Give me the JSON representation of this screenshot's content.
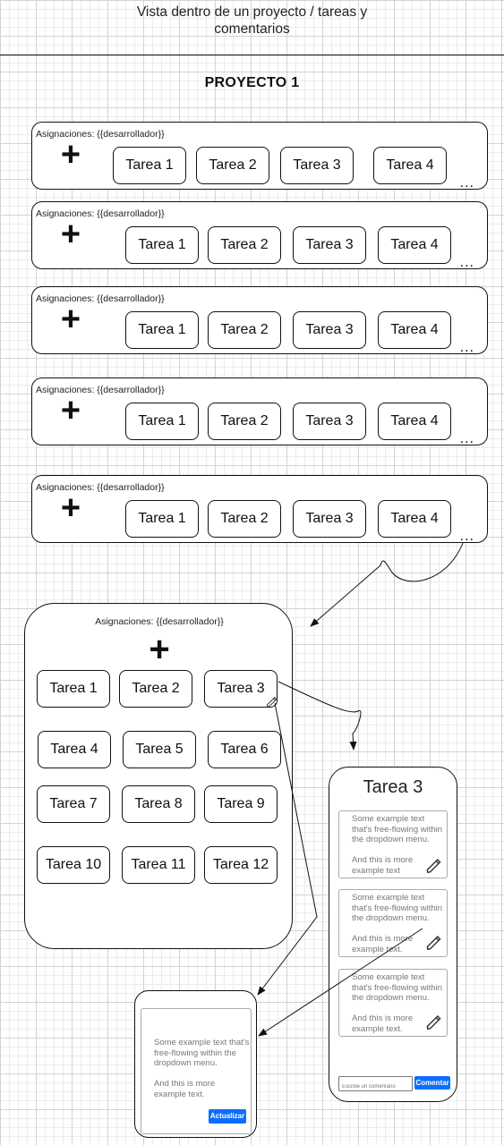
{
  "header": {
    "title_line1": "Vista dentro de un proyecto / tareas y",
    "title_line2": "comentarios",
    "project_title": "PROYECTO 1"
  },
  "rows": [
    {
      "label": "Asignaciones: {{desarrollador}}",
      "plus": "+",
      "tasks": [
        "Tarea 1",
        "Tarea 2",
        "Tarea 3",
        "Tarea 4"
      ],
      "more": "..."
    },
    {
      "label": "Asignaciones: {{desarrollador}}",
      "plus": "+",
      "tasks": [
        "Tarea 1",
        "Tarea 2",
        "Tarea 3",
        "Tarea 4"
      ],
      "more": "..."
    },
    {
      "label": "Asignaciones: {{desarrollador}}",
      "plus": "+",
      "tasks": [
        "Tarea 1",
        "Tarea 2",
        "Tarea 3",
        "Tarea 4"
      ],
      "more": "..."
    },
    {
      "label": "Asignaciones: {{desarrollador}}",
      "plus": "+",
      "tasks": [
        "Tarea 1",
        "Tarea 2",
        "Tarea 3",
        "Tarea 4"
      ],
      "more": "..."
    },
    {
      "label": "Asignaciones: {{desarrollador}}",
      "plus": "+",
      "tasks": [
        "Tarea 1",
        "Tarea 2",
        "Tarea 3",
        "Tarea 4"
      ],
      "more": "..."
    }
  ],
  "detail": {
    "label": "Asignaciones: {{desarrollador}}",
    "plus": "+",
    "tasks": [
      "Tarea 1",
      "Tarea 2",
      "Tarea 3",
      "Tarea 4",
      "Tarea 5",
      "Tarea 6",
      "Tarea 7",
      "Tarea 8",
      "Tarea 9",
      "Tarea 10",
      "Tarea 11",
      "Tarea 12"
    ],
    "edit_icon": "pencil-icon"
  },
  "task_panel": {
    "title": "Tarea 3",
    "comments": [
      {
        "text": "Some example text that's free-flowing within the dropdown menu.",
        "more": "And this is more example text",
        "icon": "pencil-icon"
      },
      {
        "text": "Some example text that's free-flowing within the dropdown menu.",
        "more": "And this is more example text.",
        "icon": "pencil-icon"
      },
      {
        "text": "Some example text that's free-flowing within the dropdown menu.",
        "more": "And this is more example text.",
        "icon": "pencil-icon"
      }
    ],
    "input_placeholder": "Escribe un comentario",
    "submit_label": "Comentar"
  },
  "edit_panel": {
    "text": "Some example text that's free-flowing within the dropdown menu.",
    "more": "And this is more example text.",
    "submit_label": "Actualizar"
  },
  "colors": {
    "button_blue": "#0d6efd",
    "line": "#111111",
    "muted_text": "#777777"
  }
}
